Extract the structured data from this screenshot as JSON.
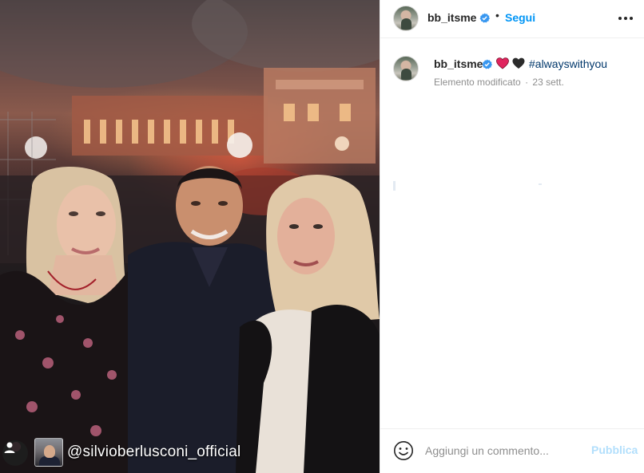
{
  "post": {
    "username": "bb_itsme",
    "dot": "•",
    "follow_label": "Segui",
    "more_icon": "more-horizontal-icon",
    "caption": {
      "hearts": [
        "red-heart",
        "black-heart"
      ],
      "hashtag": "#alwayswithyou"
    },
    "edited_label": "Elemento modificato",
    "separator": "·",
    "date": "23 sett."
  },
  "photo": {
    "tagged_account": "@silvioberlusconi_official",
    "user_tag_icon": "user-tag-icon"
  },
  "comment": {
    "placeholder": "Aggiungi un commento...",
    "publish_label": "Pubblica",
    "emoji_icon": "emoji-icon"
  },
  "colors": {
    "link_blue": "#0095f6",
    "hashtag_blue": "#00376b",
    "muted": "#8e8e8e",
    "publish_disabled": "#b2dffc",
    "verified": "#3897f0"
  }
}
